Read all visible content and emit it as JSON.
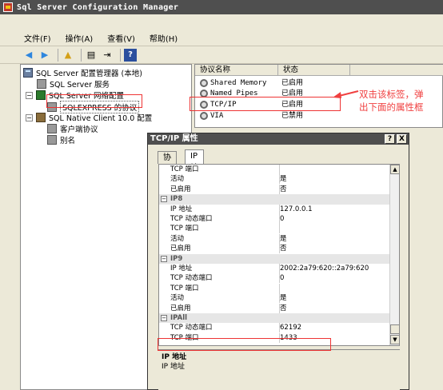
{
  "window": {
    "title": "Sql Server Configuration Manager"
  },
  "menu": [
    "文件(F)",
    "操作(A)",
    "查看(V)",
    "帮助(H)"
  ],
  "tree": {
    "root": "SQL Server 配置管理器 (本地)",
    "services": "SQL Server 服务",
    "network": "SQL Server 网络配置",
    "protocols": "SQLEXPRESS 的协议",
    "native": "SQL Native Client 10.0 配置",
    "client_protocols": "客户端协议",
    "aliases": "别名"
  },
  "list": {
    "headers": [
      "协议名称",
      "状态"
    ],
    "rows": [
      {
        "name": "Shared Memory",
        "status": "已启用"
      },
      {
        "name": "Named Pipes",
        "status": "已启用"
      },
      {
        "name": "TCP/IP",
        "status": "已启用"
      },
      {
        "name": "VIA",
        "status": "已禁用"
      }
    ]
  },
  "callout": {
    "line1": "双击该标签，弹",
    "line2": "出下面的属性框"
  },
  "dialog": {
    "title": "TCP/IP 属性",
    "help_btn": "?",
    "close_btn": "X",
    "tabs": [
      "协议",
      "IP 地址"
    ],
    "rows": [
      {
        "k": "TCP 端口",
        "v": ""
      },
      {
        "k": "活动",
        "v": "是"
      },
      {
        "k": "已启用",
        "v": "否"
      },
      {
        "group": "IP8"
      },
      {
        "k": "IP 地址",
        "v": "127.0.0.1"
      },
      {
        "k": "TCP 动态端口",
        "v": "0"
      },
      {
        "k": "TCP 端口",
        "v": ""
      },
      {
        "k": "活动",
        "v": "是"
      },
      {
        "k": "已启用",
        "v": "否"
      },
      {
        "group": "IP9"
      },
      {
        "k": "IP 地址",
        "v": "2002:2a79:620::2a79:620"
      },
      {
        "k": "TCP 动态端口",
        "v": "0"
      },
      {
        "k": "TCP 端口",
        "v": ""
      },
      {
        "k": "活动",
        "v": "是"
      },
      {
        "k": "已启用",
        "v": "否"
      },
      {
        "group": "IPAll"
      },
      {
        "k": "TCP 动态端口",
        "v": "62192"
      },
      {
        "k": "TCP 端口",
        "v": "1433"
      }
    ],
    "desc_title": "IP 地址",
    "desc_text": "IP 地址"
  }
}
